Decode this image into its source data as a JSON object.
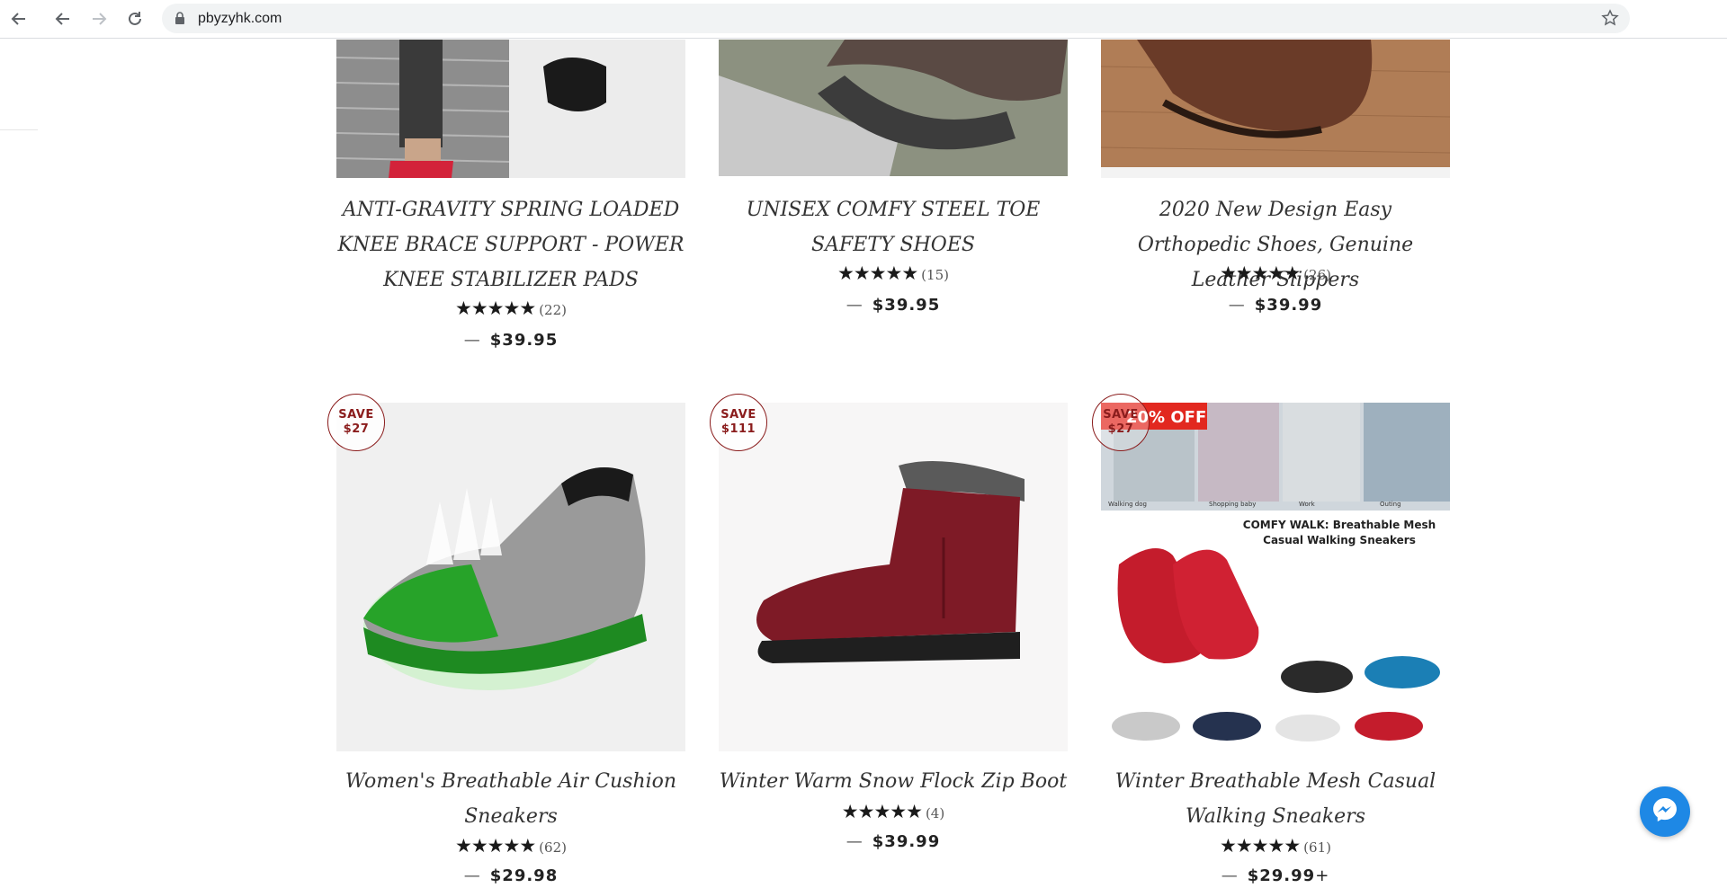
{
  "browser": {
    "url": "pbyzyhk.com",
    "icons": [
      "back-icon",
      "back-icon",
      "forward-icon",
      "reload-icon",
      "lock-icon",
      "bookmark-star-icon"
    ]
  },
  "products_row1": [
    {
      "title": "ANTI-GRAVITY SPRING LOADED KNEE BRACE SUPPORT - POWER KNEE STABILIZER PADS",
      "count": "(22)",
      "price": "$39.95"
    },
    {
      "title": "UNISEX COMFY STEEL TOE SAFETY SHOES",
      "count": "(15)",
      "price": "$39.95"
    },
    {
      "title": "2020 New Design Easy Orthopedic Shoes, Genuine Leather Slippers",
      "count": "(26)",
      "price": "$39.99"
    }
  ],
  "products_row2": [
    {
      "title": "Women's Breathable Air Cushion Sneakers",
      "count": "(62)",
      "price": "$29.98",
      "badge_line1": "SAVE",
      "badge_line2": "$27"
    },
    {
      "title": "Winter Warm Snow Flock Zip Boot",
      "count": "(4)",
      "price": "$39.99",
      "badge_line1": "SAVE",
      "badge_line2": "$111"
    },
    {
      "title": "Winter Breathable Mesh Casual Walking Sneakers",
      "count": "(61)",
      "price": "$29.99",
      "price_suffix": "+",
      "badge_line1": "SAVE",
      "badge_line2": "$27",
      "img_banner": "20% OFF",
      "img_headline": "COMFY WALK: Breathable Mesh Casual Walking Sneakers",
      "img_captions": [
        "Walking dog",
        "Shopping baby",
        "Work",
        "Outing"
      ]
    }
  ],
  "common": {
    "stars": "★★★★★",
    "dash": "—"
  },
  "colors": {
    "badge": "#8a1c1c",
    "messenger": "#1e88e5",
    "address_bar": "#f1f3f4"
  }
}
